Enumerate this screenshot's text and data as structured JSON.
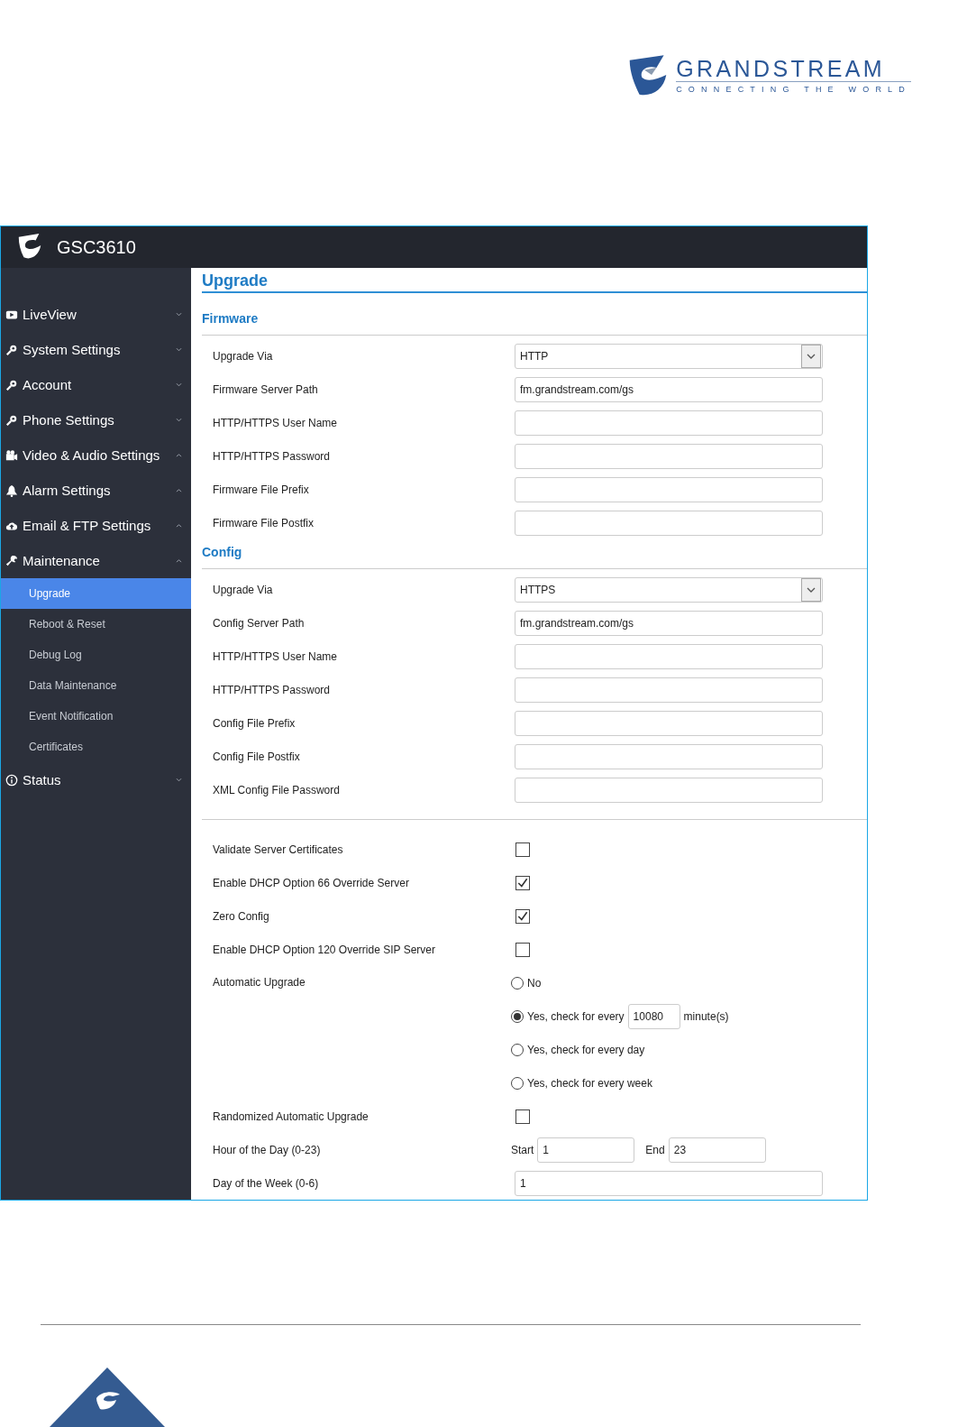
{
  "logo": {
    "name": "GRANDSTREAM",
    "tagline": "CONNECTING THE WORLD"
  },
  "app": {
    "title": "GSC3610"
  },
  "sidebar": {
    "items": [
      {
        "label": "LiveView",
        "expanded": false
      },
      {
        "label": "System Settings",
        "expanded": false
      },
      {
        "label": "Account",
        "expanded": false
      },
      {
        "label": "Phone Settings",
        "expanded": false
      },
      {
        "label": "Video & Audio Settings",
        "expanded": true
      },
      {
        "label": "Alarm Settings",
        "expanded": true
      },
      {
        "label": "Email & FTP Settings",
        "expanded": true
      },
      {
        "label": "Maintenance",
        "expanded": true,
        "children": [
          {
            "label": "Upgrade",
            "selected": true
          },
          {
            "label": "Reboot & Reset",
            "selected": false
          },
          {
            "label": "Debug Log",
            "selected": false
          },
          {
            "label": "Data Maintenance",
            "selected": false
          },
          {
            "label": "Event Notification",
            "selected": false
          },
          {
            "label": "Certificates",
            "selected": false
          }
        ]
      },
      {
        "label": "Status",
        "expanded": false
      }
    ]
  },
  "page_title": "Upgrade",
  "sections": [
    {
      "title": "Firmware",
      "rows": [
        {
          "kind": "select",
          "label": "Upgrade Via",
          "value": "HTTP"
        },
        {
          "kind": "text",
          "label": "Firmware Server Path",
          "value": "fm.grandstream.com/gs"
        },
        {
          "kind": "text",
          "label": "HTTP/HTTPS User Name"
        },
        {
          "kind": "text",
          "label": "HTTP/HTTPS Password"
        },
        {
          "kind": "text",
          "label": "Firmware File Prefix"
        },
        {
          "kind": "text",
          "label": "Firmware File Postfix"
        }
      ]
    },
    {
      "title": "Config",
      "rows": [
        {
          "kind": "select",
          "label": "Upgrade Via",
          "value": "HTTPS"
        },
        {
          "kind": "text",
          "label": "Config Server Path",
          "value": "fm.grandstream.com/gs"
        },
        {
          "kind": "text",
          "label": "HTTP/HTTPS User Name"
        },
        {
          "kind": "text",
          "label": "HTTP/HTTPS Password"
        },
        {
          "kind": "text",
          "label": "Config File Prefix"
        },
        {
          "kind": "text",
          "label": "Config File Postfix"
        },
        {
          "kind": "text",
          "label": "XML Config File Password"
        }
      ]
    },
    {
      "rows": [
        {
          "kind": "checkbox",
          "label": "Validate Server Certificates",
          "checked": false
        },
        {
          "kind": "checkbox",
          "label": "Enable DHCP Option 66 Override Server",
          "checked": true
        },
        {
          "kind": "checkbox",
          "label": "Zero Config",
          "checked": true
        },
        {
          "kind": "checkbox",
          "label": "Enable DHCP Option 120 Override SIP Server",
          "checked": false
        },
        {
          "kind": "radio",
          "label": "Automatic Upgrade",
          "options": [
            {
              "label": "No",
              "selected": false
            },
            {
              "label": "Yes, check for every",
              "selected": true,
              "value": "10080",
              "unit": "minute(s)"
            },
            {
              "label": "Yes, check for every day",
              "selected": false
            },
            {
              "label": "Yes, check for every week",
              "selected": false
            }
          ]
        },
        {
          "kind": "checkbox",
          "label": "Randomized Automatic Upgrade",
          "checked": false
        },
        {
          "kind": "range",
          "label": "Hour of the Day (0-23)",
          "start_label": "Start",
          "start": "1",
          "end_label": "End",
          "end": "23"
        },
        {
          "kind": "text",
          "label": "Day of the Week (0-6)",
          "value": "1"
        }
      ]
    }
  ]
}
